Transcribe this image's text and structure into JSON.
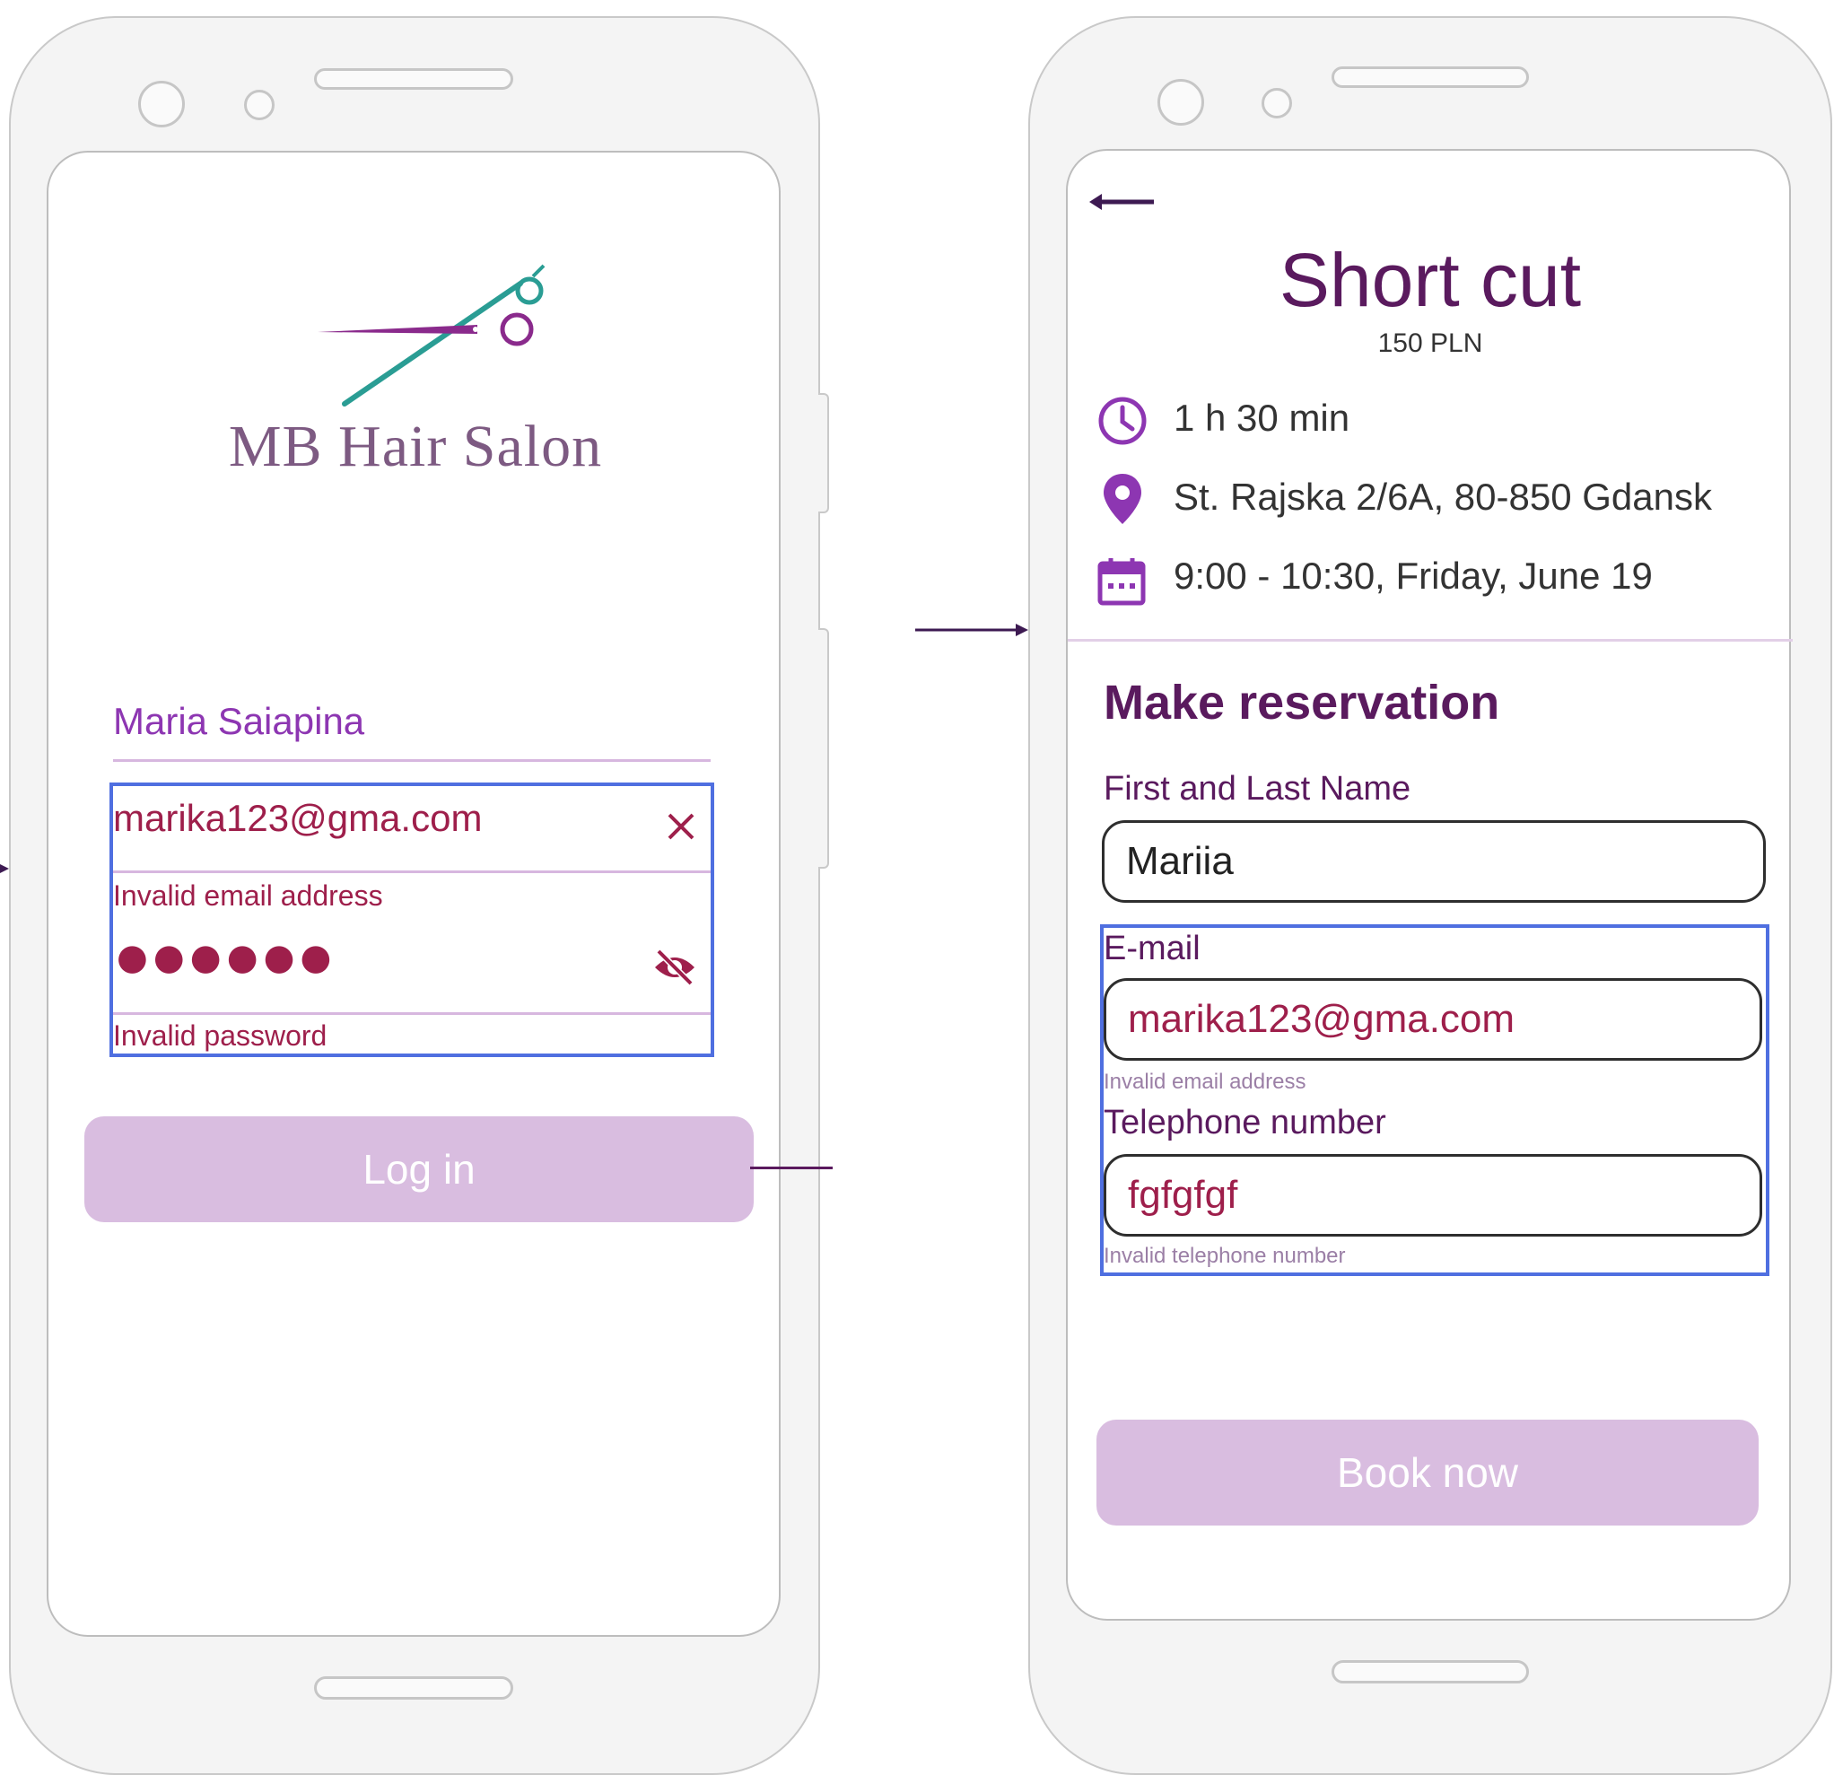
{
  "login": {
    "brand": "MB Hair Salon",
    "username": "Maria Saiapina",
    "email_value": "marika123@gma.com",
    "email_error": "Invalid email address",
    "password_masked": "●●●●●●",
    "password_error": "Invalid password",
    "login_button": "Log in"
  },
  "reservation": {
    "title": "Short cut",
    "price": "150 PLN",
    "duration": "1 h 30 min",
    "address": "St. Rajska 2/6A, 80-850 Gdansk",
    "datetime": "9:00 - 10:30, Friday, June 19",
    "section_heading": "Make reservation",
    "name_label": "First and Last Name",
    "name_value": "Mariia",
    "email_label": "E-mail",
    "email_value": "marika123@gma.com",
    "email_error": "Invalid email address",
    "phone_label": "Telephone number",
    "phone_value": "fgfgfgf",
    "phone_error": "Invalid telephone number",
    "book_button": "Book now"
  },
  "colors": {
    "accent_purple": "#8d36b2",
    "plum": "#5a1a5e",
    "error_maroon": "#9e1f4b",
    "focus_blue": "#4f6fe0",
    "disabled_button": "#d9bde0"
  }
}
